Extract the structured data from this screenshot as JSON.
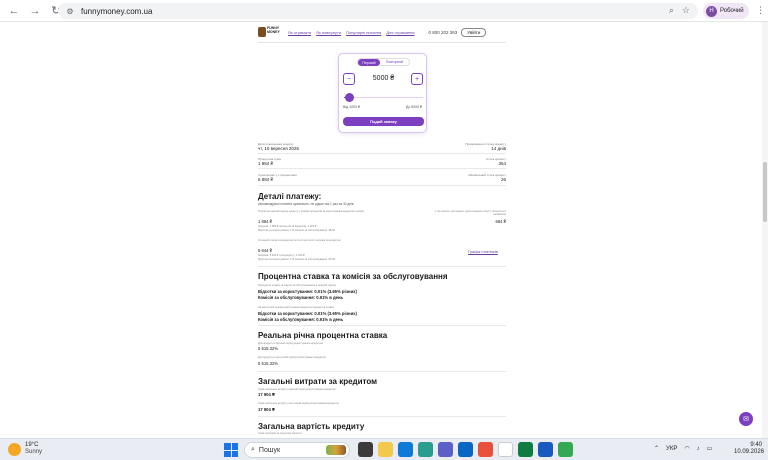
{
  "browser": {
    "url": "funnymoney.com.ua",
    "profile_initial": "Н",
    "profile_name": "Робочий"
  },
  "site": {
    "logo_text": "FUNNY MONEY",
    "nav": [
      "Як отримати",
      "Як повернути",
      "Популярні питання",
      "Для отримання"
    ],
    "phone": "0 800 202 363",
    "login_label": "Увійти"
  },
  "calculator": {
    "tab_first": "Перший",
    "tab_repeat": "Повторний",
    "minus": "−",
    "plus": "+",
    "amount": "5000 ₴",
    "min_label": "Від 1000 ₴",
    "max_label": "До 6000 ₴",
    "slider_fraction": 0.05,
    "submit_label": "Подай заявку"
  },
  "summary": [
    {
      "left_label": "Дата повернення кредиту",
      "left_value": "чт, 10 вересня 2026",
      "right_label": "Продовження строку кредиту",
      "right_value": "14 днів"
    },
    {
      "left_label": "Процентна сума",
      "left_value": "1 884 ₴",
      "right_label": "Строк кредиту",
      "right_value": "364"
    },
    {
      "left_label": "Сума кредиту з процентами",
      "left_value": "6 884 ₴",
      "right_label": "Мінімальний строк кредиту",
      "right_value": "26"
    }
  ],
  "payment": {
    "title": "Деталі платежу:",
    "subtitle": "рекомендуємо платити щомісячно, не рідше ніж 1 раз на 30 днів",
    "first_note": "Платіж за перший період кредиту у розмірі процентів за користування кредитом і комісії",
    "first_value": "1 884 ₴",
    "first_detail_1": "Зокрема: 1 884 ₴ процентів за кредитом, 1 200 ₴",
    "first_detail_2": "Відсотки за користування: 1 ₴; Комісія за обслуговування: 684 ₴",
    "right_note": "1. Не платіть частинами: сума основного боргу залишиться незмінною",
    "right_value": "684 ₴",
    "last_note": "Останній платіж за кредитом після сплати всіх платежів за кредитом",
    "last_value": "5 644 ₴",
    "last_detail_1": "Зокрема: 5 644 ₴ тіла кредиту і 1 200 ₴",
    "last_detail_2": "Відсотки за користування: 1 ₴; Комісія за обслуговування: 644 ₴",
    "schedule_link": "Графік платежів"
  },
  "rates": {
    "title": "Процентна ставка та комісія за обслуговування",
    "first_note": "Процентна ставка та комісія за обслуговування в перший період",
    "first_rate": "Відсотки за користування: 0.01% (3.65% річних)",
    "first_fee": "Комісія за обслуговування: 0.91% в день",
    "second_note": "За наступний період користування кредитом процентна ставка",
    "second_rate": "Відсотки за користування: 0.01% (3.65% річних)",
    "second_fee": "Комісія за обслуговування: 0.91% в день"
  },
  "apr": {
    "title": "Реальна річна процентна ставка",
    "first_note": "Для кредиту в перший період користування кредитом",
    "first_value": "5 515.32%",
    "second_note": "Для кредиту в наступний період користування кредитом",
    "second_value": "5 515.32%"
  },
  "costs": {
    "title": "Загальні витрати за кредитом",
    "first_note": "Сума загальних витрат у перший період користування кредитом",
    "first_value": "17 904 ₴",
    "second_note": "Сума загальних витрат у наступний період користування кредитом",
    "second_value": "17 904 ₴"
  },
  "total": {
    "title": "Загальна вартість кредиту",
    "note": "Сума платежів за кредитом загалом"
  },
  "taskbar": {
    "temperature": "19°C",
    "condition": "Sunny",
    "search_label": "Пошук",
    "language": "УКР",
    "time": "9:40",
    "date": "10.09.2026"
  }
}
